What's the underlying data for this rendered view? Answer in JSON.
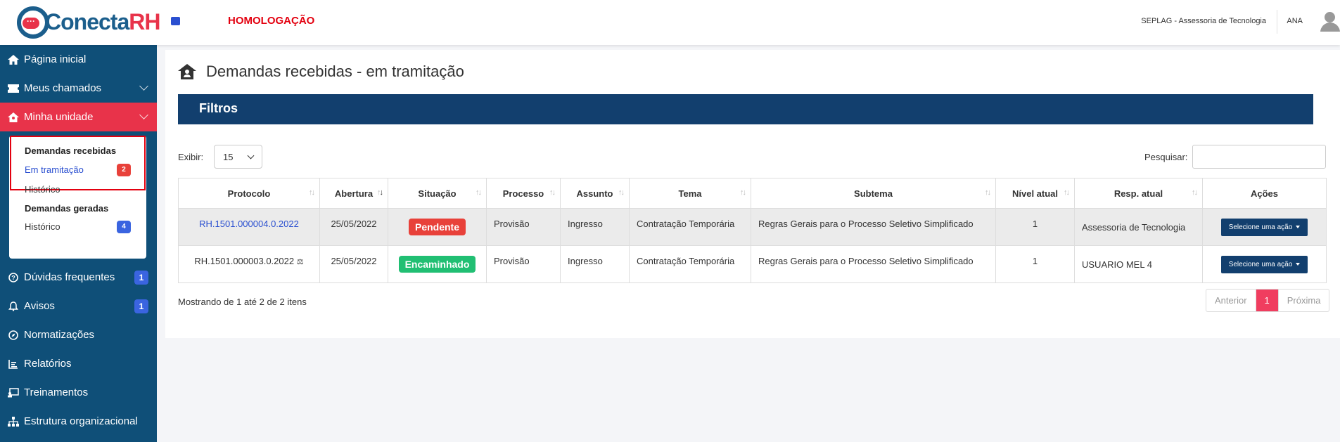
{
  "header": {
    "logo_text": "Conecta",
    "logo_rh": "RH",
    "environment": "HOMOLOGAÇÃO",
    "unit": "SEPLAG - Assessoria de Tecnologia",
    "user": "ANA",
    "brand_color": "#1b5e8c",
    "accent_color": "#e8334a"
  },
  "sidebar": {
    "items": [
      {
        "label": "Página inicial",
        "icon": "home-icon"
      },
      {
        "label": "Meus chamados",
        "icon": "ticket-icon"
      },
      {
        "label": "Minha unidade",
        "icon": "unit-home-icon"
      },
      {
        "label": "Dúvidas frequentes",
        "icon": "question-icon",
        "badge": "1"
      },
      {
        "label": "Avisos",
        "icon": "bell-icon",
        "badge": "1"
      },
      {
        "label": "Normatizações",
        "icon": "compass-icon"
      },
      {
        "label": "Relatórios",
        "icon": "report-icon"
      },
      {
        "label": "Treinamentos",
        "icon": "training-icon"
      },
      {
        "label": "Estrutura organizacional",
        "icon": "org-icon"
      }
    ],
    "submenu": {
      "received_title": "Demandas recebidas",
      "in_progress": "Em tramitação",
      "in_progress_badge": "2",
      "history1": "Histórico",
      "generated_title": "Demandas geradas",
      "history2": "Histórico",
      "history2_badge": "4"
    }
  },
  "main": {
    "title": "Demandas recebidas - em tramitação",
    "filters_label": "Filtros",
    "show_label": "Exibir:",
    "show_value": "15",
    "search_label": "Pesquisar:",
    "search_value": "",
    "columns": [
      "Protocolo",
      "Abertura",
      "Situação",
      "Processo",
      "Assunto",
      "Tema",
      "Subtema",
      "Nível atual",
      "Resp. atual",
      "Ações"
    ],
    "rows": [
      {
        "protocolo": "RH.1501.000004.0.2022",
        "abertura": "25/05/2022",
        "situacao": "Pendente",
        "processo": "Provisão",
        "assunto": "Ingresso",
        "tema": "Contratação Temporária",
        "subtema": "Regras Gerais para o Processo Seletivo Simplificado",
        "nivel": "1",
        "resp": "Assessoria de Tecnologia",
        "acao": "Selecione uma ação"
      },
      {
        "protocolo": "RH.1501.000003.0.2022",
        "abertura": "25/05/2022",
        "situacao": "Encaminhado",
        "processo": "Provisão",
        "assunto": "Ingresso",
        "tema": "Contratação Temporária",
        "subtema": "Regras Gerais para o Processo Seletivo Simplificado",
        "nivel": "1",
        "resp": "USUARIO MEL 4",
        "acao": "Selecione uma ação"
      }
    ],
    "showing_text": "Mostrando de 1 até 2 de 2 itens",
    "pager": {
      "prev": "Anterior",
      "current": "1",
      "next": "Próxima"
    }
  }
}
